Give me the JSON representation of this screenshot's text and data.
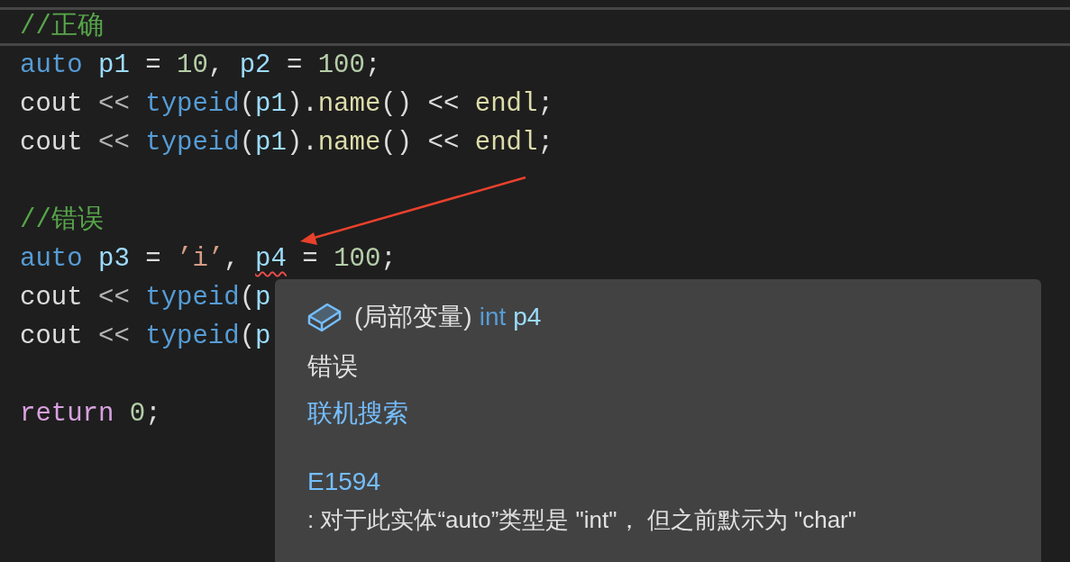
{
  "editor": {
    "lines": [
      {
        "current": true,
        "tokens": [
          {
            "text": "//正确",
            "kind": "comment",
            "error": false
          }
        ]
      },
      {
        "current": false,
        "tokens": [
          {
            "text": "auto",
            "kind": "keyword",
            "error": false
          },
          {
            "text": " p1",
            "kind": "variable",
            "error": false
          },
          {
            "text": " = ",
            "kind": "plain",
            "error": false
          },
          {
            "text": "10",
            "kind": "number",
            "error": false
          },
          {
            "text": ", ",
            "kind": "plain",
            "error": false
          },
          {
            "text": "p2",
            "kind": "variable",
            "error": false
          },
          {
            "text": " = ",
            "kind": "plain",
            "error": false
          },
          {
            "text": "100",
            "kind": "number",
            "error": false
          },
          {
            "text": ";",
            "kind": "plain",
            "error": false
          }
        ]
      },
      {
        "current": false,
        "tokens": [
          {
            "text": "cout",
            "kind": "plain",
            "error": false
          },
          {
            "text": " << ",
            "kind": "operator",
            "error": false
          },
          {
            "text": "typeid",
            "kind": "keyword",
            "error": false
          },
          {
            "text": "(",
            "kind": "plain",
            "error": false
          },
          {
            "text": "p1",
            "kind": "variable",
            "error": false
          },
          {
            "text": ").",
            "kind": "plain",
            "error": false
          },
          {
            "text": "name",
            "kind": "function",
            "error": false
          },
          {
            "text": "() << ",
            "kind": "plain",
            "error": false
          },
          {
            "text": "endl",
            "kind": "function",
            "error": false
          },
          {
            "text": ";",
            "kind": "plain",
            "error": false
          }
        ]
      },
      {
        "current": false,
        "tokens": [
          {
            "text": "cout",
            "kind": "plain",
            "error": false
          },
          {
            "text": " << ",
            "kind": "operator",
            "error": false
          },
          {
            "text": "typeid",
            "kind": "keyword",
            "error": false
          },
          {
            "text": "(",
            "kind": "plain",
            "error": false
          },
          {
            "text": "p1",
            "kind": "variable",
            "error": false
          },
          {
            "text": ").",
            "kind": "plain",
            "error": false
          },
          {
            "text": "name",
            "kind": "function",
            "error": false
          },
          {
            "text": "() << ",
            "kind": "plain",
            "error": false
          },
          {
            "text": "endl",
            "kind": "function",
            "error": false
          },
          {
            "text": ";",
            "kind": "plain",
            "error": false
          }
        ]
      },
      {
        "current": false
      },
      {
        "current": false,
        "tokens": [
          {
            "text": "//错误",
            "kind": "comment",
            "error": false
          }
        ]
      },
      {
        "current": false,
        "tokens": [
          {
            "text": "auto",
            "kind": "keyword",
            "error": false
          },
          {
            "text": " p3",
            "kind": "variable",
            "error": false
          },
          {
            "text": " = ",
            "kind": "plain",
            "error": false
          },
          {
            "text": "’i’",
            "kind": "string",
            "error": false
          },
          {
            "text": ", ",
            "kind": "plain",
            "error": false
          },
          {
            "text": "p4",
            "kind": "variable",
            "error": true
          },
          {
            "text": " = ",
            "kind": "plain",
            "error": false
          },
          {
            "text": "100",
            "kind": "number",
            "error": false
          },
          {
            "text": ";",
            "kind": "plain",
            "error": false
          }
        ]
      },
      {
        "current": false,
        "tokens": [
          {
            "text": "cout",
            "kind": "plain",
            "error": false
          },
          {
            "text": " << ",
            "kind": "operator",
            "error": false
          },
          {
            "text": "typeid",
            "kind": "keyword",
            "error": false
          },
          {
            "text": "(",
            "kind": "plain",
            "error": false
          },
          {
            "text": "p",
            "kind": "variable",
            "error": false
          }
        ]
      },
      {
        "current": false,
        "tokens": [
          {
            "text": "cout",
            "kind": "plain",
            "error": false
          },
          {
            "text": " << ",
            "kind": "operator",
            "error": false
          },
          {
            "text": "typeid",
            "kind": "keyword",
            "error": false
          },
          {
            "text": "(",
            "kind": "plain",
            "error": false
          },
          {
            "text": "p",
            "kind": "variable",
            "error": false
          }
        ]
      },
      {
        "current": false
      },
      {
        "current": false,
        "tokens": [
          {
            "text": "return",
            "kind": "control",
            "error": false
          },
          {
            "text": " 0",
            "kind": "number",
            "error": false
          },
          {
            "text": ";",
            "kind": "plain",
            "error": false
          }
        ]
      }
    ]
  },
  "tooltip": {
    "header": {
      "prefix": "(局部变量)",
      "type": "int",
      "name": "p4"
    },
    "description": "错误",
    "link": "联机搜索",
    "error_code": "E1594",
    "message": ": 对于此实体“auto”类型是 \"int\"， 但之前默示为 \"char\""
  }
}
